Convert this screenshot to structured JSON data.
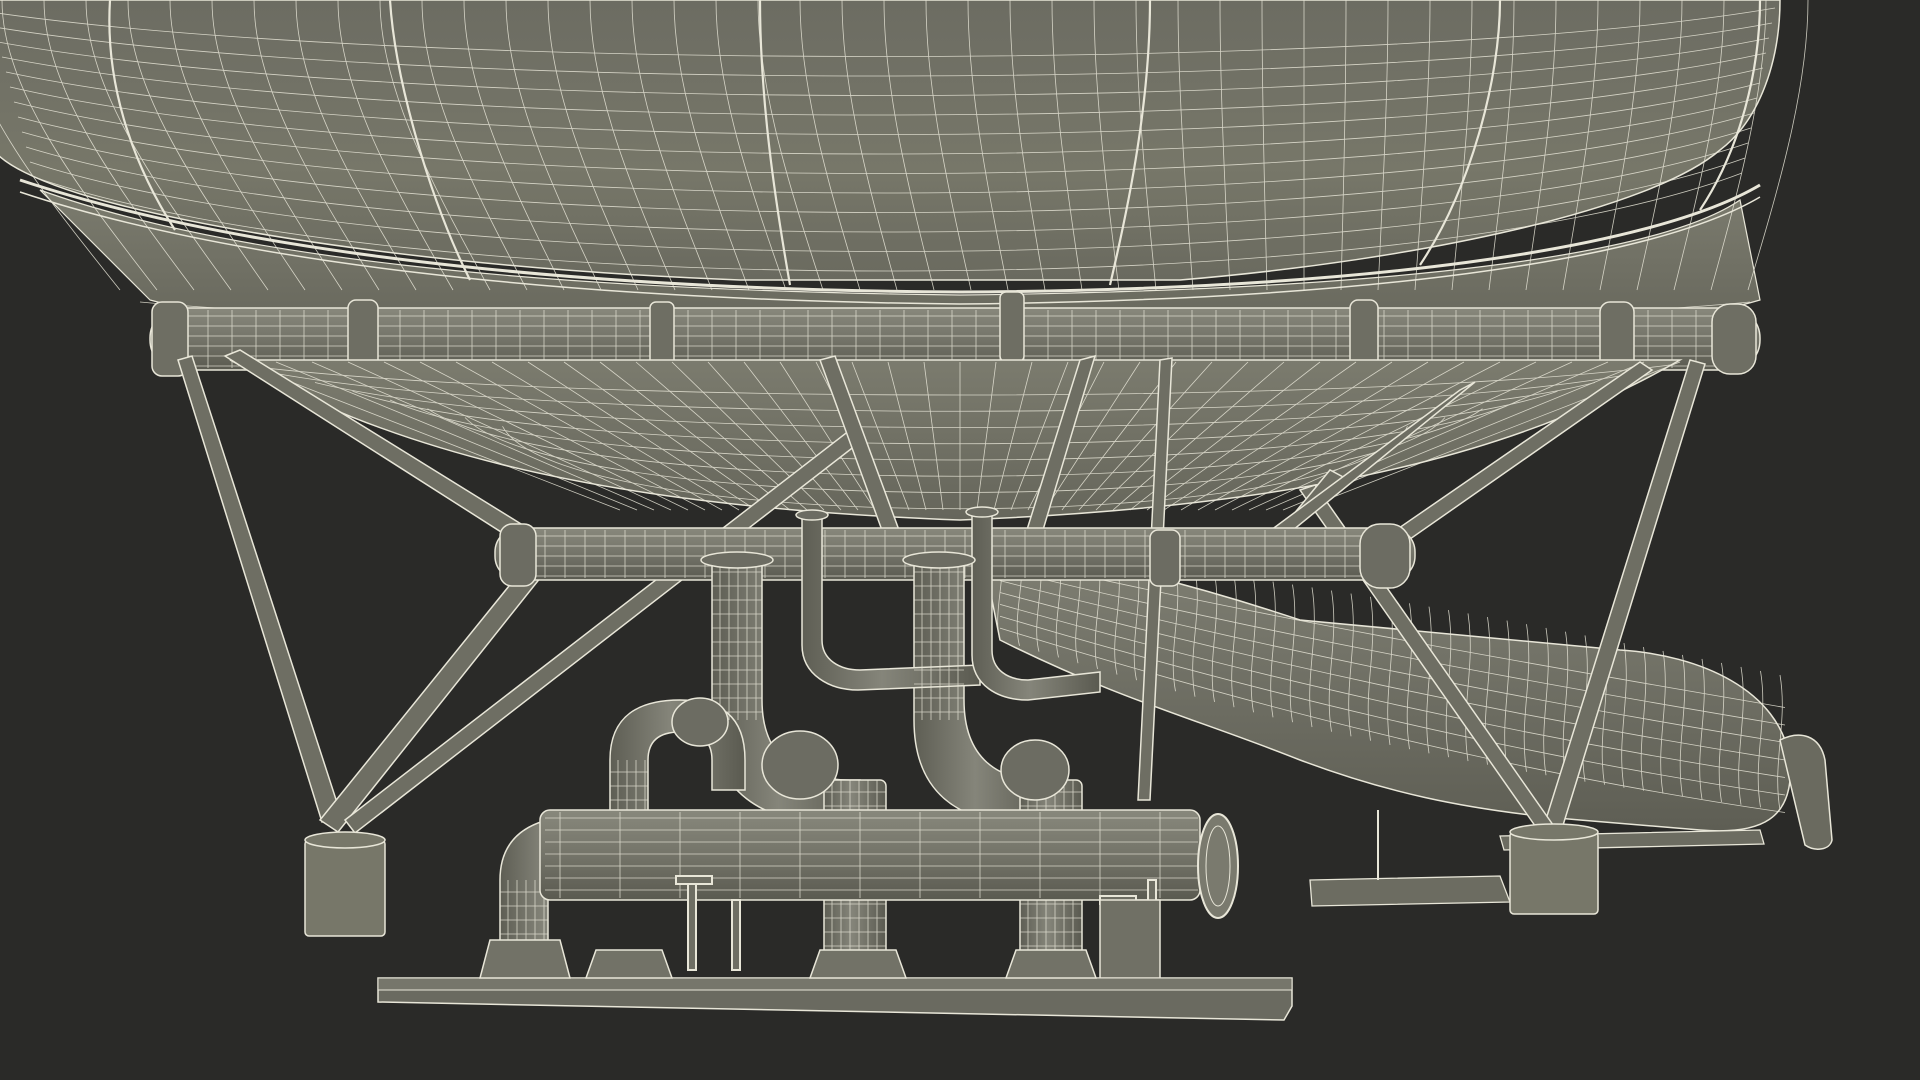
{
  "scene": {
    "background_color": "#2a2a28",
    "surface_color": "#727266",
    "surface_shade_color": "#5f5f55",
    "surface_light_color": "#8a8a7e",
    "wire_color": "#e8e6d8",
    "wire_soft_color": "#c9c7b8"
  }
}
